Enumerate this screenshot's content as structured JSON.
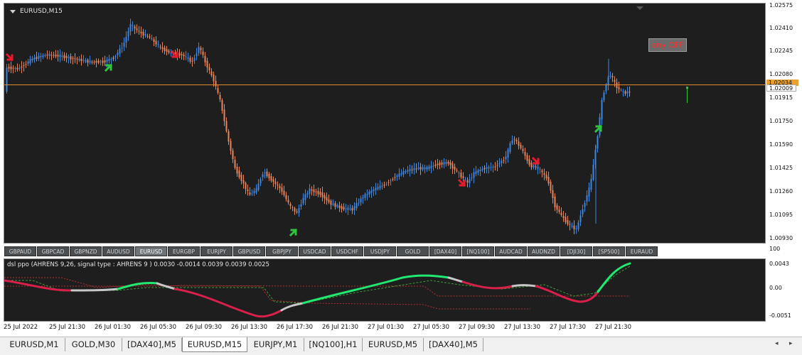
{
  "chart": {
    "title": "EURUSD,M15",
    "panel_label": "any OFF",
    "price_axis": [
      "1.02575",
      "1.02410",
      "1.02245",
      "1.02080",
      "1.01915",
      "1.01750",
      "1.01590",
      "1.01425",
      "1.01260",
      "1.01095",
      "1.00930"
    ],
    "price_tag_upper": "1.02034",
    "price_tag_lower": "1.02009",
    "colors": {
      "bull": "#3d86e3",
      "bear": "#e9845a",
      "hline": "#e58c2a",
      "up_arrow": "#2ec43e",
      "down_arrow": "#e8192c"
    }
  },
  "symbols": [
    "GBPAUD",
    "GBPCAD",
    "GBPNZD",
    "AUDUSD",
    "EURUSD",
    "EURGBP",
    "EURJPY",
    "GBPUSD",
    "GBPJPY",
    "USDCAD",
    "USDCHF",
    "USDJPY",
    "GOLD",
    "[DAX40]",
    "[NQ100]",
    "AUDCAD",
    "AUDNZD",
    "[DJI30]",
    "[SP500]",
    "EURAUD"
  ],
  "active_symbol": "EURUSD",
  "indicator": {
    "title": "dsl ppo (AHRENS 9,26, signal type : AHRENS  9 ) 0.0030 -0.0014 0.0039 0.0039 0.0025",
    "axis": [
      "100",
      "0.0043",
      "0.00",
      "-0.0051"
    ],
    "colors": {
      "up": "#20e870",
      "down": "#d8204a",
      "neutral": "#c8c8c8",
      "signal": "#3a9a3a",
      "level": "#b03030"
    }
  },
  "time_axis": [
    "25 Jul 2022",
    "25 Jul 21:30",
    "26 Jul 01:30",
    "26 Jul 05:30",
    "26 Jul 09:30",
    "26 Jul 13:30",
    "26 Jul 17:30",
    "26 Jul 21:30",
    "27 Jul 01:30",
    "27 Jul 05:30",
    "27 Jul 09:30",
    "27 Jul 13:30",
    "27 Jul 17:30",
    "27 Jul 21:30"
  ],
  "tabs": [
    "EURUSD,M1",
    "GOLD,M30",
    "[DAX40],M5",
    "EURUSD,M15",
    "EURJPY,M1",
    "[NQ100],H1",
    "EURUSD,M5",
    "[DAX40],M5"
  ],
  "active_tab": "EURUSD,M15",
  "tab_nav": {
    "prev": "◂",
    "next": "▸"
  }
}
